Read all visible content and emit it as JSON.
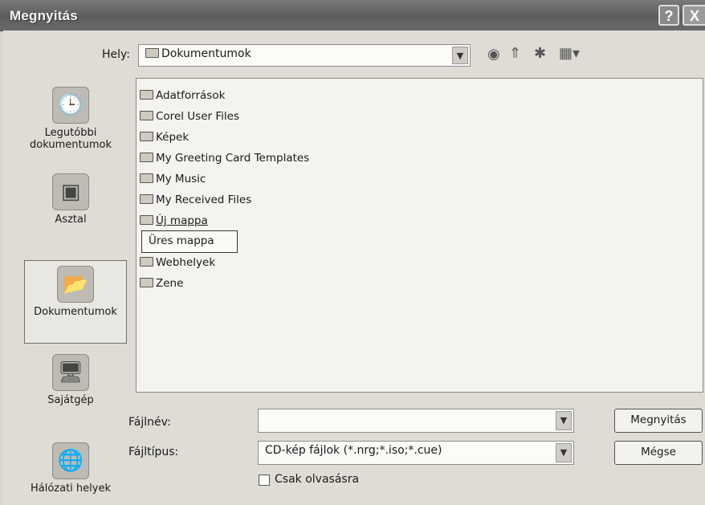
{
  "window": {
    "title": "Megnyitás",
    "help_label": "?",
    "close_label": "X"
  },
  "toolbar": {
    "location_label": "Hely:",
    "location_value": "Dokumentumok",
    "back_icon": "back-icon",
    "up_icon": "up-folder-icon",
    "new_folder_icon": "new-folder-icon",
    "views_icon": "views-menu-icon"
  },
  "places": [
    {
      "label": "Legutóbbi dokumentumok",
      "icon": "recent-documents-icon"
    },
    {
      "label": "Asztal",
      "icon": "desktop-icon"
    },
    {
      "label": "Dokumentumok",
      "icon": "documents-icon",
      "selected": true
    },
    {
      "label": "Sajátgép",
      "icon": "my-computer-icon"
    },
    {
      "label": "Hálózati helyek",
      "icon": "network-places-icon"
    }
  ],
  "files": [
    "Adatforrások",
    "Corel User Files",
    "Képek",
    "My Greeting Card Templates",
    "My Music",
    "My Received Files",
    "Új mappa",
    "Webhelyek",
    "Zene"
  ],
  "tooltip": "Üres mappa",
  "filename": {
    "label": "Fájlnév:",
    "value": ""
  },
  "filetype": {
    "label": "Fájltípus:",
    "value": "CD-kép fájlok (*.nrg;*.iso;*.cue)"
  },
  "readonly_label": "Csak olvasásra",
  "buttons": {
    "open": "Megnyitás",
    "cancel": "Mégse"
  }
}
